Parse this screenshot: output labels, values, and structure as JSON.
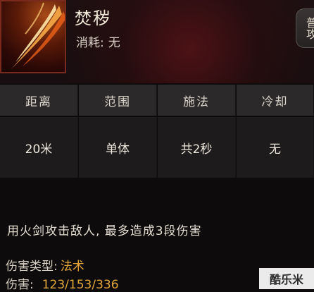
{
  "skill": {
    "name": "焚秽",
    "cost_label": "消耗:",
    "cost_value": "无",
    "type_tag": "普攻"
  },
  "stats": [
    {
      "label": "距离",
      "value": "20米"
    },
    {
      "label": "范围",
      "value": "单体"
    },
    {
      "label": "施法",
      "value": "共2秒"
    },
    {
      "label": "冷却",
      "value": "无"
    }
  ],
  "description": "用火剑攻击敌人, 最多造成3段伤害",
  "damage_type": {
    "label": "伤害类型:",
    "value": "法术"
  },
  "damage": {
    "label": "伤害:",
    "value": "123/153/336"
  },
  "watermark": "酷乐米"
}
